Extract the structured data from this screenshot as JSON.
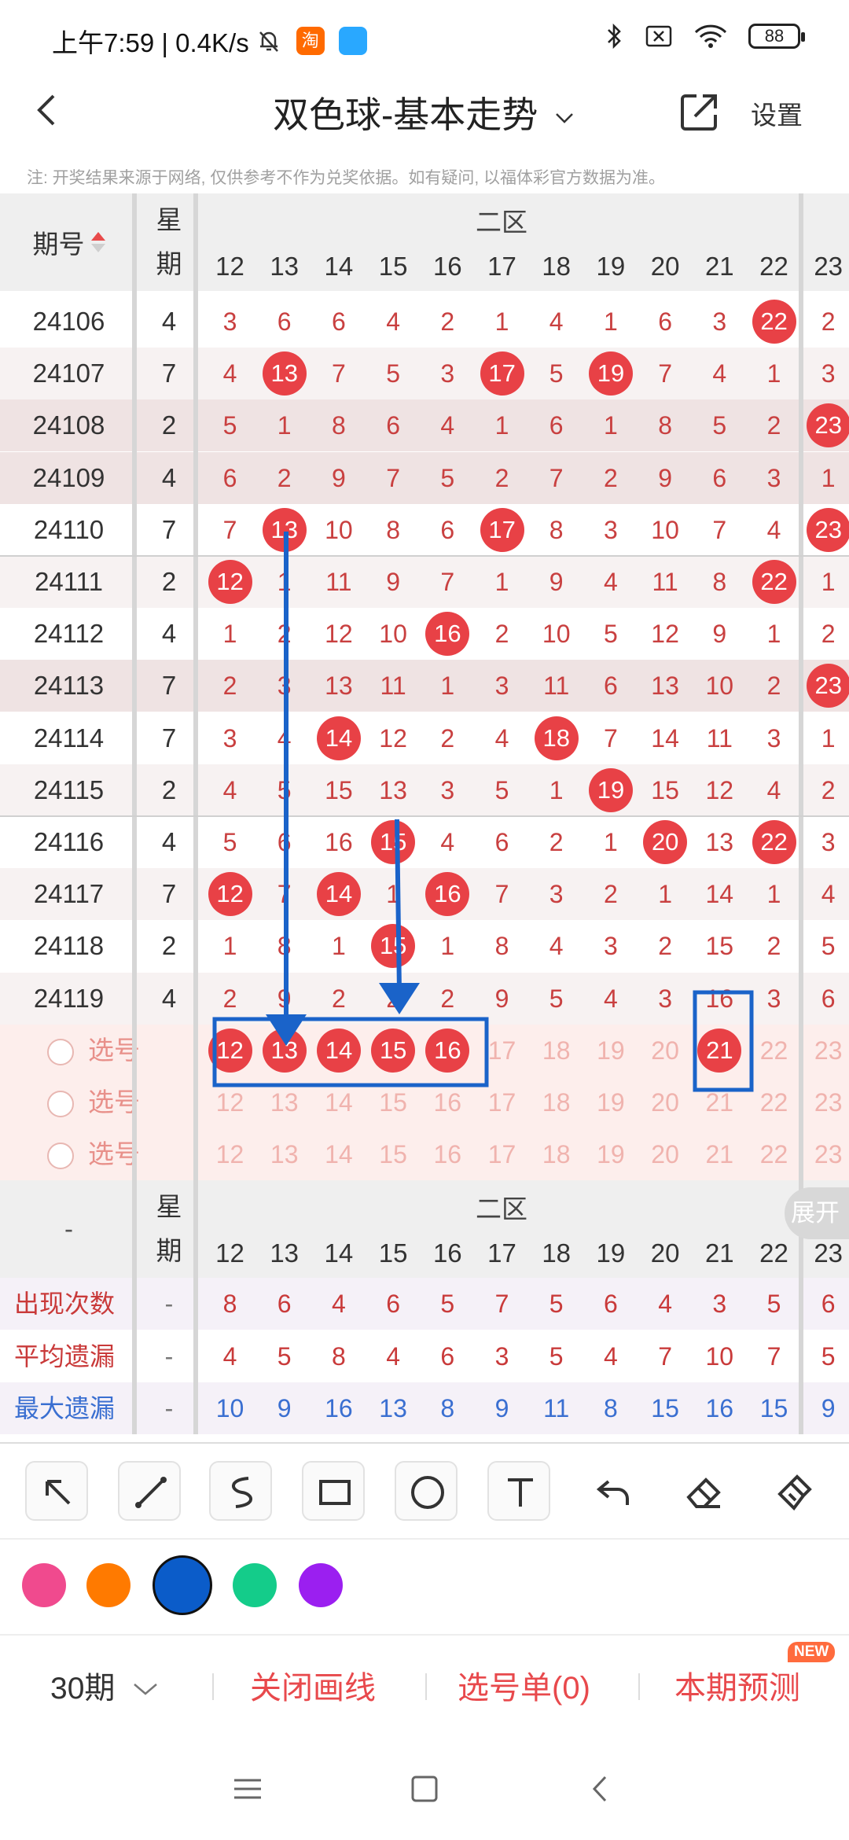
{
  "status_bar": {
    "time_net": "上午7:59 | 0.4K/s",
    "taobao": "淘",
    "battery": "88"
  },
  "header": {
    "title": "双色球-基本走势",
    "settings": "设置"
  },
  "notice": "注: 开奖结果来源于网络, 仅供参考不作为兑奖依据。如有疑问, 以福体彩官方数据为准。",
  "table": {
    "period_header": "期号",
    "week_header": "星\n期",
    "zone_label": "二区",
    "columns": [
      "12",
      "13",
      "14",
      "15",
      "16",
      "17",
      "18",
      "19",
      "20",
      "21",
      "22",
      "23"
    ],
    "rows": [
      {
        "period": "24106",
        "week": "4",
        "cells": [
          "3",
          "6",
          "6",
          "4",
          "2",
          "1",
          "4",
          "1",
          "6",
          "3",
          "22",
          "2"
        ]
      },
      {
        "period": "24107",
        "week": "7",
        "cells": [
          "4",
          "13",
          "7",
          "5",
          "3",
          "17",
          "5",
          "19",
          "7",
          "4",
          "1",
          "3"
        ]
      },
      {
        "period": "24108",
        "week": "2",
        "cells": [
          "5",
          "1",
          "8",
          "6",
          "4",
          "1",
          "6",
          "1",
          "8",
          "5",
          "2",
          "23"
        ]
      },
      {
        "period": "24109",
        "week": "4",
        "cells": [
          "6",
          "2",
          "9",
          "7",
          "5",
          "2",
          "7",
          "2",
          "9",
          "6",
          "3",
          "1"
        ]
      },
      {
        "period": "24110",
        "week": "7",
        "cells": [
          "7",
          "13",
          "10",
          "8",
          "6",
          "17",
          "8",
          "3",
          "10",
          "7",
          "4",
          "23"
        ]
      },
      {
        "period": "24111",
        "week": "2",
        "cells": [
          "12",
          "1",
          "11",
          "9",
          "7",
          "1",
          "9",
          "4",
          "11",
          "8",
          "22",
          "1"
        ]
      },
      {
        "period": "24112",
        "week": "4",
        "cells": [
          "1",
          "2",
          "12",
          "10",
          "16",
          "2",
          "10",
          "5",
          "12",
          "9",
          "1",
          "2"
        ]
      },
      {
        "period": "24113",
        "week": "7",
        "cells": [
          "2",
          "3",
          "13",
          "11",
          "1",
          "3",
          "11",
          "6",
          "13",
          "10",
          "2",
          "23"
        ]
      },
      {
        "period": "24114",
        "week": "7",
        "cells": [
          "3",
          "4",
          "14",
          "12",
          "2",
          "4",
          "18",
          "7",
          "14",
          "11",
          "3",
          "1"
        ]
      },
      {
        "period": "24115",
        "week": "2",
        "cells": [
          "4",
          "5",
          "15",
          "13",
          "3",
          "5",
          "1",
          "19",
          "15",
          "12",
          "4",
          "2"
        ]
      },
      {
        "period": "24116",
        "week": "4",
        "cells": [
          "5",
          "6",
          "16",
          "15",
          "4",
          "6",
          "2",
          "1",
          "20",
          "13",
          "22",
          "3"
        ]
      },
      {
        "period": "24117",
        "week": "7",
        "cells": [
          "12",
          "7",
          "14",
          "1",
          "16",
          "7",
          "3",
          "2",
          "1",
          "14",
          "1",
          "4"
        ]
      },
      {
        "period": "24118",
        "week": "2",
        "cells": [
          "1",
          "8",
          "1",
          "15",
          "1",
          "8",
          "4",
          "3",
          "2",
          "15",
          "2",
          "5"
        ]
      },
      {
        "period": "24119",
        "week": "4",
        "cells": [
          "2",
          "9",
          "2",
          "2",
          "2",
          "9",
          "5",
          "4",
          "3",
          "16",
          "3",
          "6"
        ]
      }
    ],
    "pick_label": "选号",
    "stats_dash": "-",
    "stats": [
      {
        "label": "出现次数",
        "color": "#c93a3a",
        "values": [
          "8",
          "6",
          "4",
          "6",
          "5",
          "7",
          "5",
          "6",
          "4",
          "3",
          "5",
          "6"
        ]
      },
      {
        "label": "平均遗漏",
        "color": "#c93a3a",
        "values": [
          "4",
          "5",
          "8",
          "4",
          "6",
          "3",
          "5",
          "4",
          "7",
          "10",
          "7",
          "5"
        ]
      },
      {
        "label": "最大遗漏",
        "color": "#3a6fd1",
        "values": [
          "10",
          "9",
          "16",
          "13",
          "8",
          "9",
          "11",
          "8",
          "15",
          "16",
          "15",
          "9"
        ]
      }
    ],
    "expand": "展开"
  },
  "tools": [
    "arrow-tool",
    "line-tool",
    "curve-tool",
    "rect-tool",
    "circle-tool",
    "text-tool",
    "undo-tool",
    "eraser-tool",
    "clear-tool"
  ],
  "colors": [
    "#f04a8e",
    "#ff7a00",
    "#0b5cc9",
    "#14cc8a",
    "#9b1ff0"
  ],
  "footer": {
    "periods": "30期",
    "close_draw": "关闭画线",
    "pick_list": "选号单(0)",
    "predict": "本期预测",
    "new_badge": "NEW"
  }
}
